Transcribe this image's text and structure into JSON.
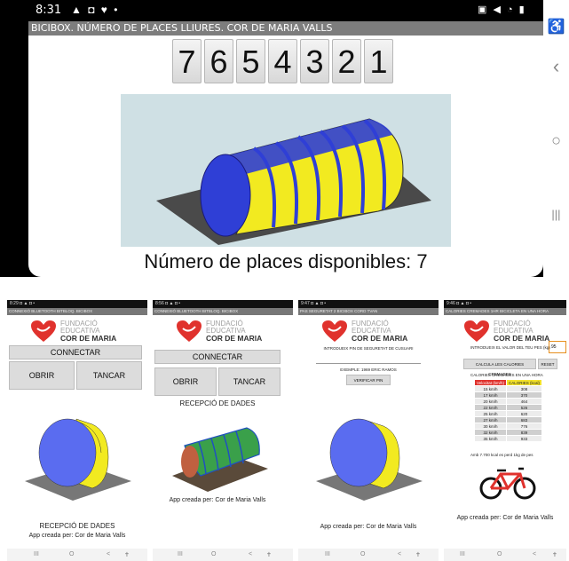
{
  "top": {
    "status_time": "8:31",
    "status_icons_left": "▲ ◘ ♥ •",
    "status_icons_right": "▣ ◀ ◔ ▮",
    "title": "BICIBOX. NÚMERO DE PLACES LLIURES. COR DE MARIA VALLS",
    "digits": [
      "7",
      "6",
      "5",
      "4",
      "3",
      "2",
      "1"
    ],
    "caption": "Número de places disponibles: 7",
    "nav": {
      "accessibility": "♿",
      "back": "‹",
      "home": "○",
      "recents": "|||"
    }
  },
  "logo": {
    "line1": "FUNDACIÓ",
    "line2": "EDUCATIVA",
    "line3": "COR DE MARIA",
    "heart_color": "#e0322d"
  },
  "phone1": {
    "status": "8:29 ◘ ▲ ◘ •",
    "title": "CONNEXIÓ BLUETOOTH BITBLOQ. BICIBOX",
    "connect": "CONNECTAR",
    "open": "OBRIR",
    "close": "TANCAR",
    "reception": "RECEPCIÓ DE DADES",
    "credit": "App creada per: Cor de Maria Valls"
  },
  "phone2": {
    "status": "8:56 ◘ ▲ ◘ •",
    "title": "CONNEXIÓ BLUETOOTH BITBLOQ. BICIBOX",
    "connect": "CONNECTAR",
    "open": "OBRIR",
    "close": "TANCAR",
    "reception": "RECEPCIÓ DE DADES",
    "credit": "App creada per: Cor de Maria Valls"
  },
  "phone3": {
    "status": "9:47 ◘ ▲ ◘ •",
    "title": "PAS SEGURETAT 2 BICIBOX CORD TVAN",
    "pin_prompt": "INTRODUEIX PIN DE SEGURETAT DE CUSUARI",
    "example": "EXEMPLE: 1969 ERIC RAMOS",
    "verify": "VERIFICAR PIN",
    "credit": "App creada per: Cor de Maria Valls"
  },
  "phone4": {
    "status": "9:46 ◘ ▲ ◘ •",
    "title": "CALORIES CREMADES 1HR BICICLETA EN UNA HORA",
    "weight_prompt": "INTRODUEIX EL VALOR DEL TEU PES (kg)",
    "weight_value": "95",
    "calc": "CALCULA LES CALORIES CREMADES",
    "reset": "RESET",
    "table_title": "CALORIES CREMADES EN UNA HORA",
    "table_header": [
      "Velocitat (km/h)",
      "CALORIES (kcal)"
    ],
    "rows": [
      [
        "15 km/h",
        "308"
      ],
      [
        "17 km/h",
        "370"
      ],
      [
        "20 km/h",
        "464"
      ],
      [
        "22 km/h",
        "526"
      ],
      [
        "25 km/h",
        "620"
      ],
      [
        "27 km/h",
        "683"
      ],
      [
        "30 km/h",
        "776"
      ],
      [
        "32 km/h",
        "839"
      ],
      [
        "35 km/h",
        "933"
      ]
    ],
    "footnote": "Amb 7.700 kcal es perd 1kg de pes",
    "credit": "App creada per: Cor de Maria Valls",
    "bike_color": "#e0322d"
  },
  "small_nav": {
    "recents": "III",
    "home": "O",
    "back": "<",
    "accessibility": "✝"
  }
}
